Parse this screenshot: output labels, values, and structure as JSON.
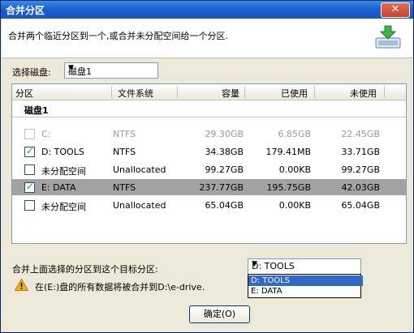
{
  "window": {
    "title": "合并分区"
  },
  "header": {
    "description": "合并两个临近分区到一个,或合并未分配空间给一个分区."
  },
  "disk_select": {
    "label": "选择磁盘:",
    "value": "磁盘1"
  },
  "table": {
    "columns": [
      "分区",
      "文件系统",
      "容量",
      "已使用",
      "未使用"
    ],
    "group": "磁盘1",
    "rows": [
      {
        "name": "C:",
        "fs": "NTFS",
        "capacity": "29.30GB",
        "used": "6.85GB",
        "free": "22.45GB",
        "checked": false,
        "disabled": true,
        "selected": false
      },
      {
        "name": "D:  TOOLS",
        "fs": "NTFS",
        "capacity": "34.38GB",
        "used": "179.41MB",
        "free": "33.71GB",
        "checked": true,
        "disabled": false,
        "selected": false
      },
      {
        "name": "未分配空间",
        "fs": "Unallocated",
        "capacity": "99.27GB",
        "used": "0.00KB",
        "free": "99.27GB",
        "checked": false,
        "disabled": false,
        "selected": false
      },
      {
        "name": "E:  DATA",
        "fs": "NTFS",
        "capacity": "237.77GB",
        "used": "195.75GB",
        "free": "42.03GB",
        "checked": true,
        "disabled": false,
        "selected": true
      },
      {
        "name": "未分配空间",
        "fs": "Unallocated",
        "capacity": "65.04GB",
        "used": "0.00KB",
        "free": "65.04GB",
        "checked": false,
        "disabled": false,
        "selected": false
      }
    ]
  },
  "target": {
    "label": "合并上面选择的分区到这个目标分区:",
    "value": "D:  TOOLS",
    "options": [
      "D:  TOOLS",
      "E:  DATA"
    ]
  },
  "warning": {
    "text": "在(E:)盘的所有数据将被合并到D:\\e-drive."
  },
  "ok_button": {
    "label": "确定(O)"
  }
}
